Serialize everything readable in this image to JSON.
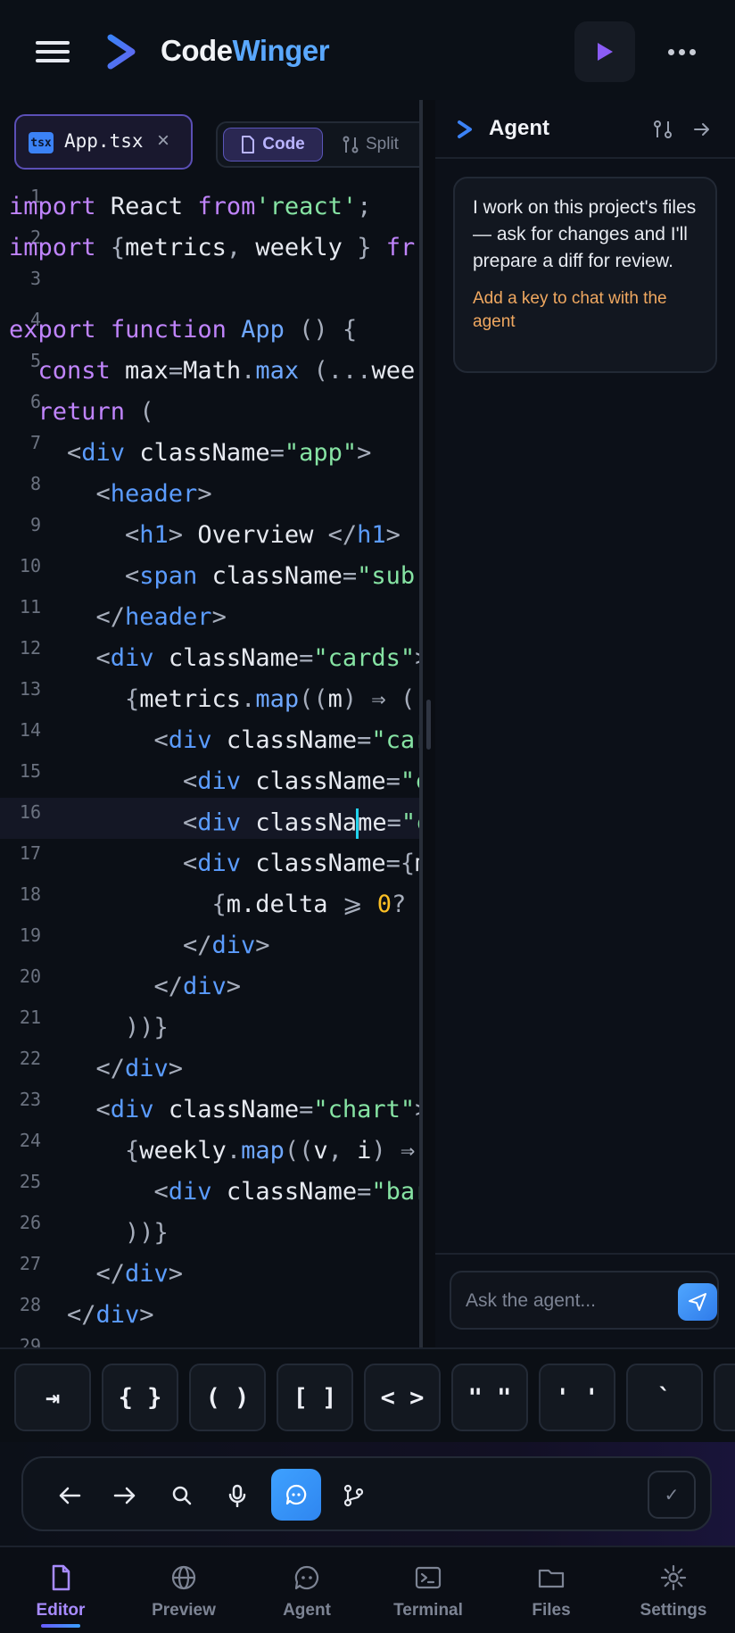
{
  "app": {
    "brand_part1": "Code",
    "brand_part2": "Winger",
    "colors": {
      "accent": "#5aa8ff",
      "purple": "#8b5cf6",
      "warning": "#f0a860",
      "bg": "#0a0d13"
    }
  },
  "editor": {
    "file_tab": {
      "badge": "tsx",
      "name": "App.tsx",
      "close": "×"
    },
    "view_toggle": {
      "code_label": "Code",
      "split_label": "Split"
    },
    "active_line": 16,
    "lines": [
      {
        "n": "1",
        "indent": 0,
        "tokens": [
          [
            "kw",
            "import"
          ],
          [
            "",
            "React"
          ],
          [
            "kw",
            "from"
          ],
          [
            "str",
            "'react'"
          ],
          [
            "pun",
            ";"
          ]
        ]
      },
      {
        "n": "2",
        "indent": 0,
        "tokens": [
          [
            "kw",
            "import"
          ],
          [
            "pun",
            "{"
          ],
          [
            "",
            "metrics"
          ],
          [
            "pun",
            ","
          ],
          [
            "",
            "weekly"
          ],
          [
            "pun",
            "}"
          ],
          [
            "kw",
            "fr"
          ]
        ]
      },
      {
        "n": "3",
        "indent": 0,
        "tokens": []
      },
      {
        "n": "4",
        "indent": 0,
        "tokens": [
          [
            "kw",
            "export"
          ],
          [
            "kw",
            "function"
          ],
          [
            "fn",
            "App"
          ],
          [
            "pun",
            "()"
          ],
          [
            "pun",
            "{"
          ]
        ]
      },
      {
        "n": "5",
        "indent": 1,
        "tokens": [
          [
            "kw",
            "const"
          ],
          [
            "",
            "max"
          ],
          [
            "pun",
            "="
          ],
          [
            "",
            "Math"
          ],
          [
            "pun",
            "."
          ],
          [
            "fn",
            "max"
          ],
          [
            "pun",
            "(..."
          ],
          [
            "",
            "wee"
          ]
        ]
      },
      {
        "n": "6",
        "indent": 1,
        "tokens": [
          [
            "kw",
            "return"
          ],
          [
            "pun",
            "("
          ]
        ]
      },
      {
        "n": "7",
        "indent": 2,
        "tokens": [
          [
            "pun",
            "<"
          ],
          [
            "tag",
            "div"
          ],
          [
            "",
            "className"
          ],
          [
            "pun",
            "="
          ],
          [
            "str",
            "\"app\""
          ],
          [
            "pun",
            ">"
          ]
        ]
      },
      {
        "n": "8",
        "indent": 3,
        "tokens": [
          [
            "pun",
            "<"
          ],
          [
            "tag",
            "header"
          ],
          [
            "pun",
            ">"
          ]
        ]
      },
      {
        "n": "9",
        "indent": 4,
        "tokens": [
          [
            "pun",
            "<"
          ],
          [
            "tag",
            "h1"
          ],
          [
            "pun",
            ">"
          ],
          [
            "",
            "Overview"
          ],
          [
            "pun",
            "</"
          ],
          [
            "tag",
            "h1"
          ],
          [
            "pun",
            ">"
          ]
        ]
      },
      {
        "n": "10",
        "indent": 4,
        "tokens": [
          [
            "pun",
            "<"
          ],
          [
            "tag",
            "span"
          ],
          [
            "",
            "className"
          ],
          [
            "pun",
            "="
          ],
          [
            "str",
            "\"sub'"
          ]
        ]
      },
      {
        "n": "11",
        "indent": 3,
        "tokens": [
          [
            "pun",
            "</"
          ],
          [
            "tag",
            "header"
          ],
          [
            "pun",
            ">"
          ]
        ]
      },
      {
        "n": "12",
        "indent": 3,
        "tokens": [
          [
            "pun",
            "<"
          ],
          [
            "tag",
            "div"
          ],
          [
            "",
            "className"
          ],
          [
            "pun",
            "="
          ],
          [
            "str",
            "\"cards\""
          ],
          [
            "pun",
            ">"
          ]
        ]
      },
      {
        "n": "13",
        "indent": 4,
        "tokens": [
          [
            "pun",
            "{"
          ],
          [
            "",
            "metrics"
          ],
          [
            "pun",
            "."
          ],
          [
            "fn",
            "map"
          ],
          [
            "pun",
            "(("
          ],
          [
            "",
            "m"
          ],
          [
            "pun",
            ")"
          ],
          [
            "pun",
            "⇒"
          ],
          [
            "pun",
            "("
          ]
        ]
      },
      {
        "n": "14",
        "indent": 5,
        "tokens": [
          [
            "pun",
            "<"
          ],
          [
            "tag",
            "div"
          ],
          [
            "",
            "className"
          ],
          [
            "pun",
            "="
          ],
          [
            "str",
            "\"car"
          ]
        ]
      },
      {
        "n": "15",
        "indent": 6,
        "tokens": [
          [
            "pun",
            "<"
          ],
          [
            "tag",
            "div"
          ],
          [
            "",
            "className"
          ],
          [
            "pun",
            "="
          ],
          [
            "str",
            "\"c"
          ]
        ]
      },
      {
        "n": "16",
        "indent": 6,
        "tokens": [
          [
            "pun",
            "<"
          ],
          [
            "tag",
            "div"
          ],
          [
            "",
            "classNa"
          ],
          [
            "caret",
            ""
          ],
          [
            "",
            "me"
          ],
          [
            "pun",
            "="
          ],
          [
            "str",
            "\"c"
          ]
        ]
      },
      {
        "n": "17",
        "indent": 6,
        "tokens": [
          [
            "pun",
            "<"
          ],
          [
            "tag",
            "div"
          ],
          [
            "",
            "className"
          ],
          [
            "pun",
            "="
          ],
          [
            "pun",
            "{"
          ],
          [
            "",
            "m"
          ]
        ]
      },
      {
        "n": "18",
        "indent": 7,
        "tokens": [
          [
            "pun",
            "{"
          ],
          [
            "",
            "m.delta"
          ],
          [
            "pun",
            "⩾"
          ],
          [
            "num",
            "0"
          ],
          [
            "pun",
            "?"
          ]
        ]
      },
      {
        "n": "19",
        "indent": 6,
        "tokens": [
          [
            "pun",
            "</"
          ],
          [
            "tag",
            "div"
          ],
          [
            "pun",
            ">"
          ]
        ]
      },
      {
        "n": "20",
        "indent": 5,
        "tokens": [
          [
            "pun",
            "</"
          ],
          [
            "tag",
            "div"
          ],
          [
            "pun",
            ">"
          ]
        ]
      },
      {
        "n": "21",
        "indent": 4,
        "tokens": [
          [
            "pun",
            "))}"
          ]
        ]
      },
      {
        "n": "22",
        "indent": 3,
        "tokens": [
          [
            "pun",
            "</"
          ],
          [
            "tag",
            "div"
          ],
          [
            "pun",
            ">"
          ]
        ]
      },
      {
        "n": "23",
        "indent": 3,
        "tokens": [
          [
            "pun",
            "<"
          ],
          [
            "tag",
            "div"
          ],
          [
            "",
            "className"
          ],
          [
            "pun",
            "="
          ],
          [
            "str",
            "\"chart\""
          ],
          [
            "pun",
            ">"
          ]
        ]
      },
      {
        "n": "24",
        "indent": 4,
        "tokens": [
          [
            "pun",
            "{"
          ],
          [
            "",
            "weekly"
          ],
          [
            "pun",
            "."
          ],
          [
            "fn",
            "map"
          ],
          [
            "pun",
            "(("
          ],
          [
            "",
            "v"
          ],
          [
            "pun",
            ","
          ],
          [
            "",
            "i"
          ],
          [
            "pun",
            ")"
          ],
          [
            "pun",
            "⇒"
          ]
        ]
      },
      {
        "n": "25",
        "indent": 5,
        "tokens": [
          [
            "pun",
            "<"
          ],
          [
            "tag",
            "div"
          ],
          [
            "",
            "className"
          ],
          [
            "pun",
            "="
          ],
          [
            "str",
            "\"bar"
          ]
        ]
      },
      {
        "n": "26",
        "indent": 4,
        "tokens": [
          [
            "pun",
            "))}"
          ]
        ]
      },
      {
        "n": "27",
        "indent": 3,
        "tokens": [
          [
            "pun",
            "</"
          ],
          [
            "tag",
            "div"
          ],
          [
            "pun",
            ">"
          ]
        ]
      },
      {
        "n": "28",
        "indent": 2,
        "tokens": [
          [
            "pun",
            "</"
          ],
          [
            "tag",
            "div"
          ],
          [
            "pun",
            ">"
          ]
        ]
      },
      {
        "n": "29",
        "indent": 0,
        "tokens": []
      }
    ]
  },
  "agent": {
    "title": "Agent",
    "message": "I work on this project's files — ask for changes and I'll prepare a diff for review.",
    "warning": "Add a key to chat with the agent",
    "input_placeholder": "Ask the agent..."
  },
  "symbols": [
    "⇥",
    "{ }",
    "( )",
    "[ ]",
    "< >",
    "\" \"",
    "' '",
    "`",
    ""
  ],
  "action_bar": {
    "buttons": [
      "back-arrow-icon",
      "forward-arrow-icon",
      "search-icon",
      "microphone-icon",
      "agent-chat-icon",
      "git-branch-icon"
    ],
    "check": "✓"
  },
  "nav": {
    "items": [
      {
        "label": "Editor",
        "icon": "file-icon",
        "active": true
      },
      {
        "label": "Preview",
        "icon": "globe-icon",
        "active": false
      },
      {
        "label": "Agent",
        "icon": "chat-icon",
        "active": false
      },
      {
        "label": "Terminal",
        "icon": "terminal-icon",
        "active": false
      },
      {
        "label": "Files",
        "icon": "folder-icon",
        "active": false
      },
      {
        "label": "Settings",
        "icon": "gear-icon",
        "active": false
      }
    ]
  }
}
